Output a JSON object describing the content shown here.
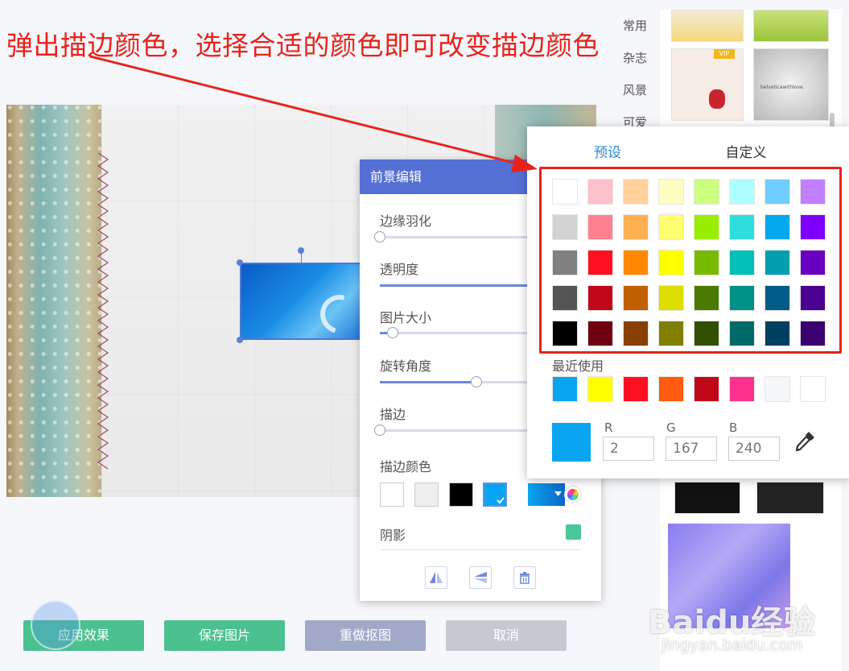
{
  "annotation": "弹出描边颜色，选择合适的颜色即可改变描边颜色",
  "library": {
    "categories": [
      "常用",
      "杂志",
      "风景",
      "可爱"
    ],
    "thumb_vip_badge": "VIP",
    "thumb_text": "helveticawithlove."
  },
  "editor": {
    "title": "前景编辑",
    "labels": {
      "feather": "边缘羽化",
      "opacity": "透明度",
      "size": "图片大小",
      "rotation": "旋转角度",
      "stroke": "描边",
      "stroke_color": "描边颜色",
      "shadow": "阴影"
    },
    "slider_values": {
      "feather": 0.0,
      "opacity": 1.0,
      "size": 0.08,
      "rotation": 0.6,
      "stroke": 0.0
    },
    "stroke_swatches": [
      "#ffffff",
      "#eeeeee",
      "#000000",
      "#0aa5f0"
    ],
    "current_stroke_color": "#0aa5f0",
    "shadow_color": "#4ac89a"
  },
  "picker": {
    "tab_preset": "预设",
    "tab_custom": "自定义",
    "preset_colors": [
      [
        "#ffffff",
        "#ffc0cb",
        "#ffd39b",
        "#ffffc0",
        "#ccff80",
        "#b0ffff",
        "#70cfff",
        "#c080ff"
      ],
      [
        "#d3d3d3",
        "#ff8090",
        "#ffb050",
        "#ffff70",
        "#99ee00",
        "#30dddd",
        "#00a8ee",
        "#8000ff"
      ],
      [
        "#808080",
        "#ff1020",
        "#ff8800",
        "#ffff00",
        "#77bb00",
        "#00c0b8",
        "#00a0b0",
        "#6a00c0"
      ],
      [
        "#555555",
        "#c00818",
        "#c06000",
        "#dddd00",
        "#4a7a00",
        "#009088",
        "#005c88",
        "#4a0090"
      ],
      [
        "#000000",
        "#700010",
        "#884000",
        "#808000",
        "#305000",
        "#006b68",
        "#004060",
        "#3a0070"
      ]
    ],
    "recent_label": "最近使用",
    "recent_colors": [
      "#0aa5f0",
      "#ffff00",
      "#ff1020",
      "#ff5a10",
      "#c00818",
      "#ff3090",
      "#f5f7fb",
      "#ffffff"
    ],
    "preview_color": "#0aa5f0",
    "r_label": "R",
    "g_label": "G",
    "b_label": "B",
    "r_value": "2",
    "g_value": "167",
    "b_value": "240"
  },
  "buttons": {
    "apply": "应用效果",
    "save": "保存图片",
    "redo_matting": "重做抠图",
    "cancel": "取消"
  },
  "watermark": {
    "main": "Baidu经验",
    "sub": "jingyan.baidu.com"
  }
}
